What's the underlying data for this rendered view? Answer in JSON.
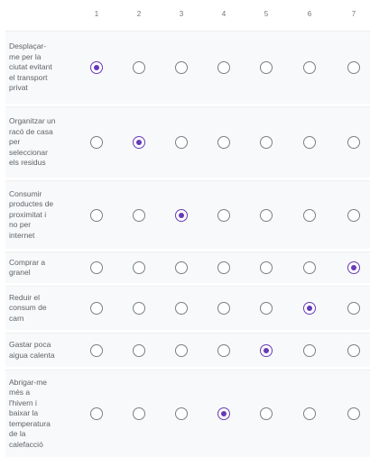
{
  "scale_labels": [
    "1",
    "2",
    "3",
    "4",
    "5",
    "6",
    "7"
  ],
  "rows": [
    {
      "label": "Desplaçar-\nme per la\nciutat evitant\nel transport\nprivat",
      "selected": 1
    },
    {
      "label": "Organitzar un\nracó de casa\nper\nseleccionar\nels residus",
      "selected": 2
    },
    {
      "label": "Consumir\nproductes de\nproximitat i\nno per\ninternet",
      "selected": 3
    },
    {
      "label": "Comprar a\ngranel",
      "selected": 7
    },
    {
      "label": "Reduir el\nconsum de\ncarn",
      "selected": 6
    },
    {
      "label": "Gastar poca\naigua calenta",
      "selected": 5
    },
    {
      "label": "Abrigar-me\nmés a\nl'hivern i\nbaixar la\ntemperatura\nde la\ncalefacció",
      "selected": 4
    }
  ],
  "colors": {
    "accent": "#673ab7",
    "row_background": "#f8f9fa",
    "radio_border": "#7a7f85"
  }
}
